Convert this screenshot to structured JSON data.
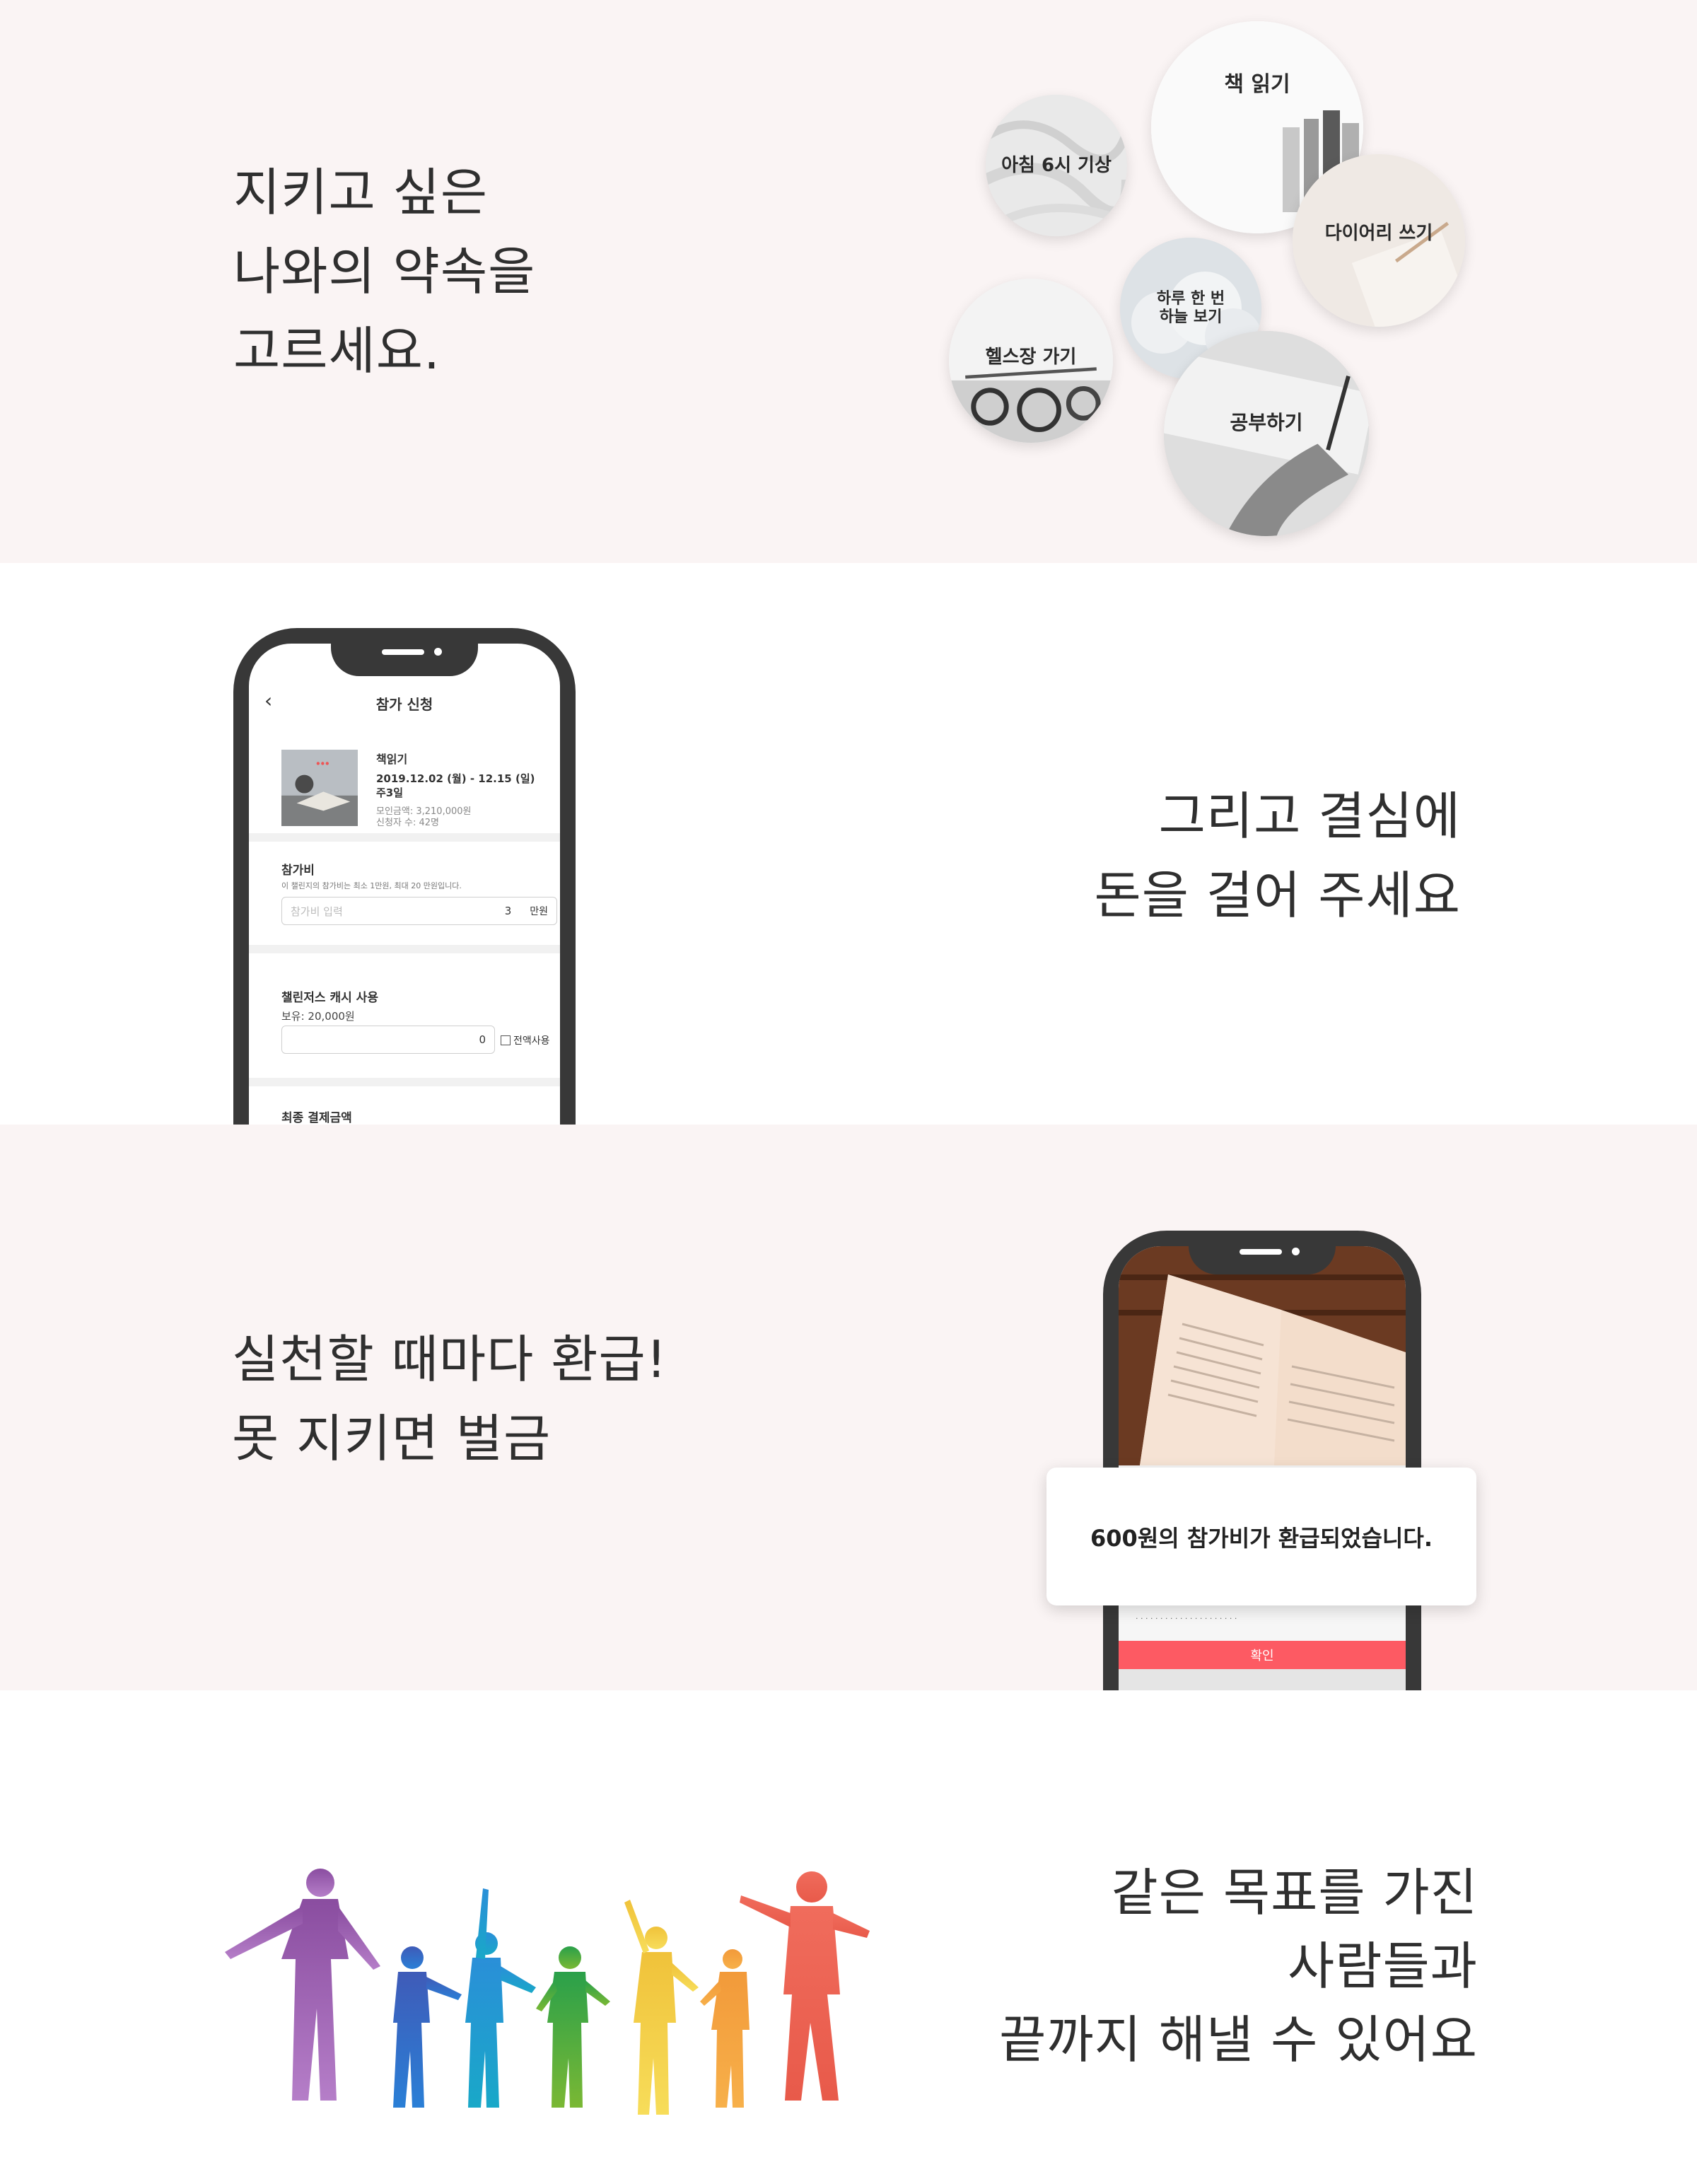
{
  "section1": {
    "headline": [
      "지키고 싶은",
      "나와의 약속을",
      "고르세요."
    ],
    "circles": [
      "아침 6시 기상",
      "책 읽기",
      "다이어리 쓰기",
      "하루 한 번\n하늘 보기",
      "헬스장 가기",
      "공부하기"
    ]
  },
  "section2": {
    "headline": [
      "그리고 결심에",
      "돈을 걸어 주세요"
    ],
    "phone": {
      "title": "참가 신청",
      "challenge_name": "책읽기",
      "date_range": "2019.12.02 (월) - 12.15 (일)",
      "frequency": "주3일",
      "raised": "모인금액: 3,210,000원",
      "participants": "신청자 수: 42명",
      "fee_title": "참가비",
      "fee_note": "이 챌린지의 참가비는 최소 1만원, 최대 20 만원입니다.",
      "fee_placeholder": "참가비 입력",
      "fee_value": "3",
      "fee_unit": "만원",
      "cash_title": "챌린저스 캐시 사용",
      "cash_balance": "보유: 20,000원",
      "cash_value": "0",
      "cash_all": "전액사용",
      "final_title": "최종 결제금액"
    }
  },
  "section3": {
    "headline": [
      "실천할 때마다 환급!",
      "못 지키면 벌금"
    ],
    "toast": "600원의 참가비가 환급되었습니다.",
    "confirm": "확인"
  },
  "section4": {
    "headline": [
      "같은 목표를 가진",
      "사람들과",
      "끝까지 해낼 수 있어요"
    ]
  }
}
